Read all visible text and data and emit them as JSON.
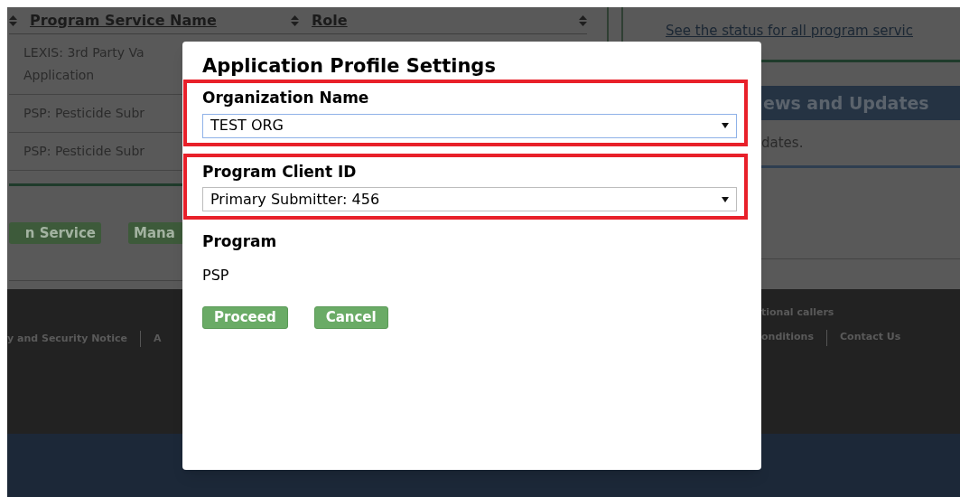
{
  "table": {
    "columns": [
      {
        "label": "Program Service Name"
      },
      {
        "label": "Role"
      }
    ],
    "rows": [
      {
        "lines": [
          "LEXIS: 3rd Party Va",
          "Application"
        ]
      },
      {
        "lines": [
          "PSP: Pesticide Subr"
        ]
      },
      {
        "lines": [
          "PSP: Pesticide Subr"
        ]
      }
    ]
  },
  "page_buttons": [
    "n Service",
    "Mana"
  ],
  "status_link": "See the status for all program servic",
  "news": {
    "heading": "ews and Updates",
    "text": "dates."
  },
  "footer": {
    "note": "tional callers",
    "left_links": [
      "y and Security Notice",
      "A"
    ],
    "right_links": [
      "onditions",
      "Contact Us"
    ]
  },
  "dialog": {
    "title": "Application Profile Settings",
    "fields": [
      {
        "label": "Organization Name",
        "value": "TEST ORG",
        "focused": true,
        "highlighted": true
      },
      {
        "label": "Program Client ID",
        "value": "Primary Submitter: 456",
        "focused": false,
        "highlighted": true
      }
    ],
    "program": {
      "label": "Program",
      "value": "PSP"
    },
    "buttons": [
      {
        "label": "Proceed"
      },
      {
        "label": "Cancel"
      }
    ]
  }
}
